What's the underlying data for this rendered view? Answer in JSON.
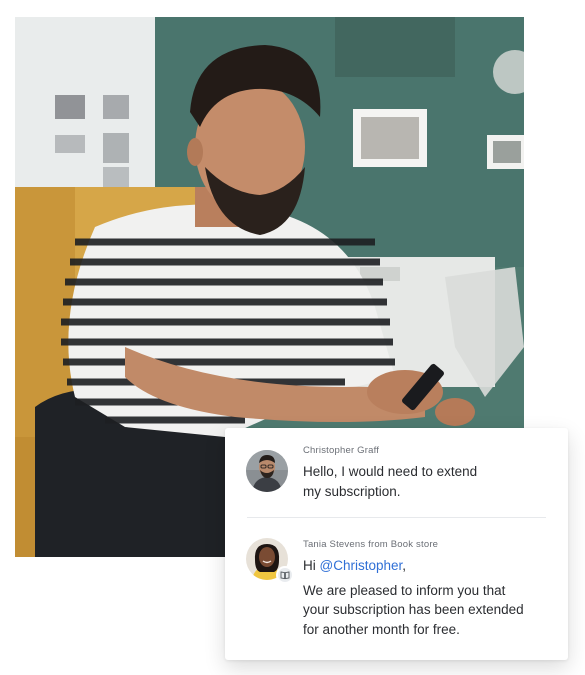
{
  "chat": {
    "messages": [
      {
        "sender": "Christopher Graff",
        "line1": "Hello, I would need to extend",
        "line2": "my subscription."
      },
      {
        "sender": "Tania Stevens from Book store",
        "greeting_prefix": "Hi ",
        "mention": "@Christopher",
        "greeting_suffix": ",",
        "line1": "We are pleased to inform you that",
        "line2": "your subscription has been extended",
        "line3": "for another month for free."
      }
    ],
    "badge_icon": "book-icon"
  },
  "colors": {
    "mention": "#2f6fd6",
    "wall": "#4f7a70",
    "chair": "#d6a648",
    "text": "#2b2d31",
    "muted": "#6b6f76"
  }
}
